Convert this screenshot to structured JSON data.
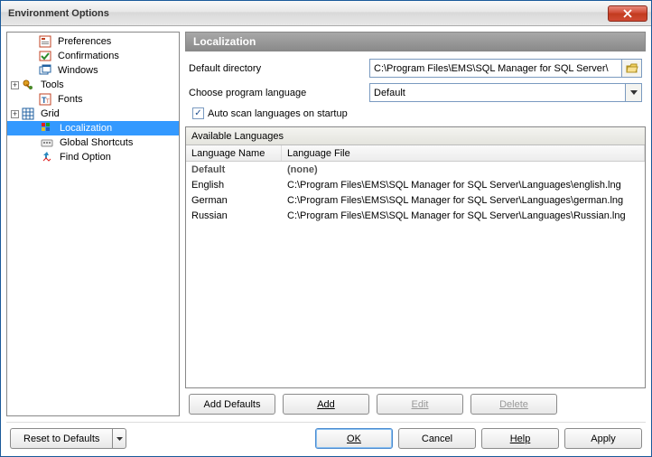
{
  "window": {
    "title": "Environment Options"
  },
  "tree": {
    "items": [
      {
        "label": "Preferences",
        "icon": "pref"
      },
      {
        "label": "Confirmations",
        "icon": "confirm"
      },
      {
        "label": "Windows",
        "icon": "windows"
      },
      {
        "label": "Tools",
        "icon": "tools",
        "expandable": true
      },
      {
        "label": "Fonts",
        "icon": "fonts"
      },
      {
        "label": "Grid",
        "icon": "grid",
        "expandable": true
      },
      {
        "label": "Localization",
        "icon": "local",
        "selected": true
      },
      {
        "label": "Global Shortcuts",
        "icon": "shortcuts"
      },
      {
        "label": "Find Option",
        "icon": "find"
      }
    ]
  },
  "panel": {
    "header": "Localization",
    "default_dir_label": "Default directory",
    "default_dir_value": "C:\\Program Files\\EMS\\SQL Manager for SQL Server\\",
    "choose_lang_label": "Choose program language",
    "choose_lang_value": "Default",
    "autoscan_label": "Auto scan languages on startup",
    "autoscan_checked": true,
    "grid_title": "Available Languages",
    "col_name": "Language Name",
    "col_file": "Language File",
    "rows": [
      {
        "name": "Default",
        "file": "(none)",
        "selected": true
      },
      {
        "name": "English",
        "file": "C:\\Program Files\\EMS\\SQL Manager for SQL Server\\Languages\\english.lng"
      },
      {
        "name": "German",
        "file": "C:\\Program Files\\EMS\\SQL Manager for SQL Server\\Languages\\german.lng"
      },
      {
        "name": "Russian",
        "file": "C:\\Program Files\\EMS\\SQL Manager for SQL Server\\Languages\\Russian.lng"
      }
    ],
    "buttons": {
      "add_defaults": "Add Defaults",
      "add": "Add",
      "edit": "Edit",
      "delete": "Delete"
    }
  },
  "footer": {
    "reset": "Reset to Defaults",
    "ok": "OK",
    "cancel": "Cancel",
    "help": "Help",
    "apply": "Apply"
  }
}
